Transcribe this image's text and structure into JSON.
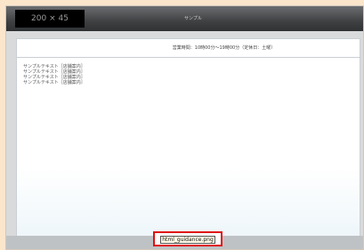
{
  "header": {
    "logo_placeholder": "200 × 45",
    "site_title": "サンプル"
  },
  "panel": {
    "hours_text": "営業時間：10時00分～19時00分（定休日：土曜）",
    "lines": [
      "サンプルテキスト［店舗案内］",
      "サンプルテキスト［店舗案内］",
      "サンプルテキスト［店舗案内］",
      "サンプルテキスト［店舗案内］"
    ]
  },
  "footer": {
    "filename": "html_guidance.png"
  }
}
